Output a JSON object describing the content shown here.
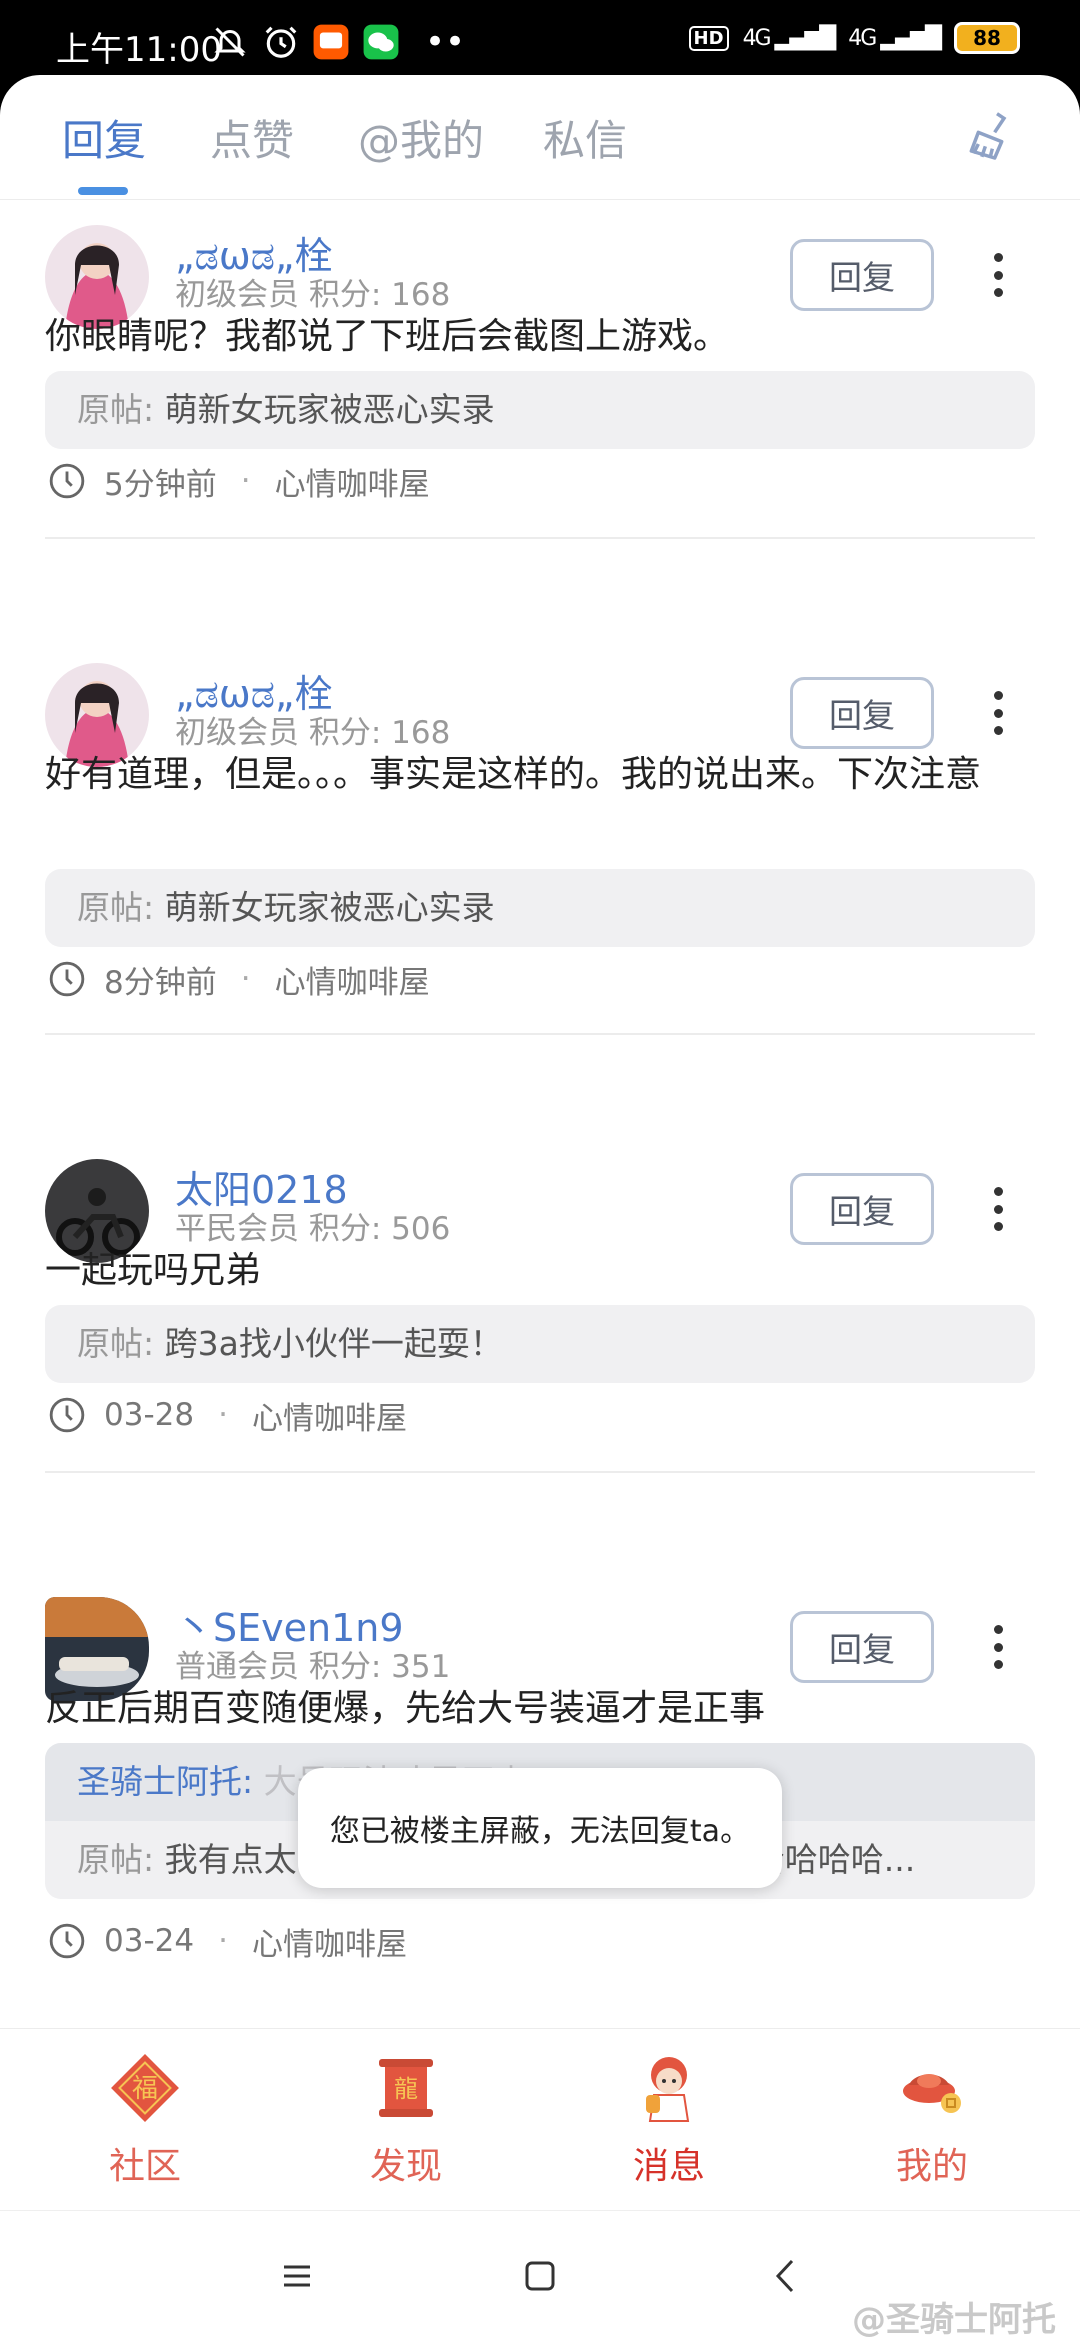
{
  "status_bar": {
    "time": "上午11:00",
    "hd": "HD",
    "net1": "4G",
    "net2": "4G",
    "battery": "88"
  },
  "tabs": [
    {
      "label": "回复",
      "active": true
    },
    {
      "label": "点赞",
      "active": false
    },
    {
      "label": "@我的",
      "active": false
    },
    {
      "label": "私信",
      "active": false
    }
  ],
  "posts": [
    {
      "username": "„ಡωಡ„栓",
      "level": "初级会员",
      "points_label": "积分: 168",
      "reply_label": "回复",
      "content": "你眼睛呢？我都说了下班后会截图上游戏。",
      "orig_label": "原帖:",
      "orig_title": "萌新女玩家被恶心实录",
      "time": "5分钟前",
      "forum": "心情咖啡屋"
    },
    {
      "username": "„ಡωಡ„栓",
      "level": "初级会员",
      "points_label": "积分: 168",
      "reply_label": "回复",
      "content": "好有道理，但是。。。事实是这样的。我的说出来。下次注意",
      "orig_label": "原帖:",
      "orig_title": "萌新女玩家被恶心实录",
      "time": "8分钟前",
      "forum": "心情咖啡屋"
    },
    {
      "username": "太阳0218",
      "level": "平民会员",
      "points_label": "积分: 506",
      "reply_label": "回复",
      "content": "一起玩吗兄弟",
      "orig_label": "原帖:",
      "orig_title": "跨3a找小伙伴一起耍！",
      "time": "03-28",
      "forum": "心情咖啡屋"
    },
    {
      "username": "丶SEven1n9",
      "level": "普通会员",
      "points_label": "积分: 351",
      "reply_label": "回复",
      "content": "反正后期百变随便爆，先给大号装逼才是正事",
      "quote_user": "圣骑士阿托:",
      "quote_text": "大号玩法才是正事",
      "orig_label": "原帖:",
      "orig_title": "我有点太牛逼了吧，全身百变+大龙珠 · 哈哈哈哈...",
      "time": "03-24",
      "forum": "心情咖啡屋"
    }
  ],
  "toast": "您已被楼主屏蔽，无法回复ta。",
  "bottom_nav": [
    {
      "label": "社区",
      "icon": "fu-icon",
      "active": false
    },
    {
      "label": "发现",
      "icon": "dragon-scroll-icon",
      "active": false
    },
    {
      "label": "消息",
      "icon": "mascot-icon",
      "active": true
    },
    {
      "label": "我的",
      "icon": "gold-ingot-icon",
      "active": false
    }
  ],
  "watermark": "@圣骑士阿托",
  "colors": {
    "accent_blue": "#4a78c8",
    "nav_red": "#e06456",
    "nav_active_red": "#d6322a"
  }
}
